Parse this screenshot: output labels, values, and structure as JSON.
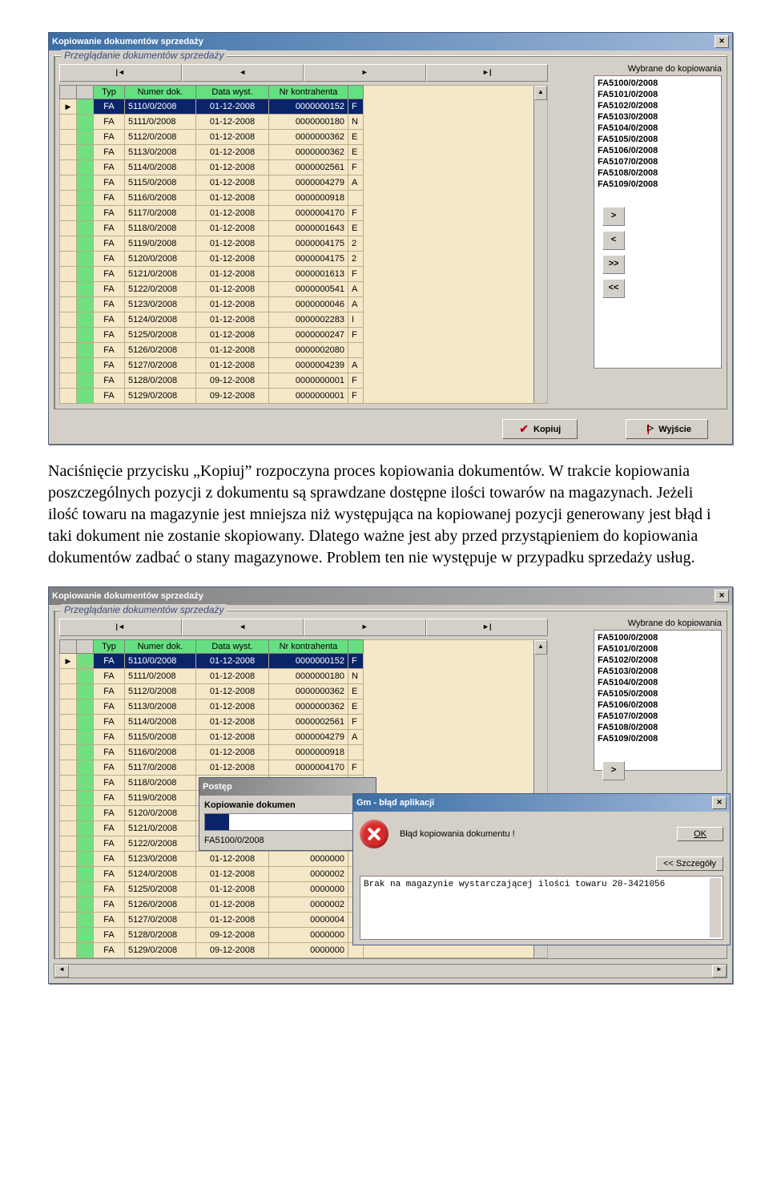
{
  "window_title": "Kopiowanie dokumentów sprzedaży",
  "group_legend": "Przeglądanie dokumentów sprzedaży",
  "columns": {
    "typ": "Typ",
    "num": "Numer dok.",
    "date": "Data wyst.",
    "kontr": "Nr kontrahenta"
  },
  "rows": [
    {
      "typ": "FA",
      "num": "5110/0/2008",
      "date": "01-12-2008",
      "kontr": "0000000152",
      "x": "F",
      "sel": true
    },
    {
      "typ": "FA",
      "num": "5111/0/2008",
      "date": "01-12-2008",
      "kontr": "0000000180",
      "x": "N"
    },
    {
      "typ": "FA",
      "num": "5112/0/2008",
      "date": "01-12-2008",
      "kontr": "0000000362",
      "x": "E"
    },
    {
      "typ": "FA",
      "num": "5113/0/2008",
      "date": "01-12-2008",
      "kontr": "0000000362",
      "x": "E"
    },
    {
      "typ": "FA",
      "num": "5114/0/2008",
      "date": "01-12-2008",
      "kontr": "0000002561",
      "x": "F"
    },
    {
      "typ": "FA",
      "num": "5115/0/2008",
      "date": "01-12-2008",
      "kontr": "0000004279",
      "x": "A"
    },
    {
      "typ": "FA",
      "num": "5116/0/2008",
      "date": "01-12-2008",
      "kontr": "0000000918",
      "x": ""
    },
    {
      "typ": "FA",
      "num": "5117/0/2008",
      "date": "01-12-2008",
      "kontr": "0000004170",
      "x": "F"
    },
    {
      "typ": "FA",
      "num": "5118/0/2008",
      "date": "01-12-2008",
      "kontr": "0000001643",
      "x": "E"
    },
    {
      "typ": "FA",
      "num": "5119/0/2008",
      "date": "01-12-2008",
      "kontr": "0000004175",
      "x": "2"
    },
    {
      "typ": "FA",
      "num": "5120/0/2008",
      "date": "01-12-2008",
      "kontr": "0000004175",
      "x": "2"
    },
    {
      "typ": "FA",
      "num": "5121/0/2008",
      "date": "01-12-2008",
      "kontr": "0000001613",
      "x": "F"
    },
    {
      "typ": "FA",
      "num": "5122/0/2008",
      "date": "01-12-2008",
      "kontr": "0000000541",
      "x": "A"
    },
    {
      "typ": "FA",
      "num": "5123/0/2008",
      "date": "01-12-2008",
      "kontr": "0000000046",
      "x": "A"
    },
    {
      "typ": "FA",
      "num": "5124/0/2008",
      "date": "01-12-2008",
      "kontr": "0000002283",
      "x": "I"
    },
    {
      "typ": "FA",
      "num": "5125/0/2008",
      "date": "01-12-2008",
      "kontr": "0000000247",
      "x": "F"
    },
    {
      "typ": "FA",
      "num": "5126/0/2008",
      "date": "01-12-2008",
      "kontr": "0000002080",
      "x": ""
    },
    {
      "typ": "FA",
      "num": "5127/0/2008",
      "date": "01-12-2008",
      "kontr": "0000004239",
      "x": "A"
    },
    {
      "typ": "FA",
      "num": "5128/0/2008",
      "date": "09-12-2008",
      "kontr": "0000000001",
      "x": "F"
    },
    {
      "typ": "FA",
      "num": "5129/0/2008",
      "date": "09-12-2008",
      "kontr": "0000000001",
      "x": "F"
    }
  ],
  "rows2": [
    {
      "typ": "FA",
      "num": "5110/0/2008",
      "date": "01-12-2008",
      "kontr": "0000000152",
      "x": "F",
      "sel": true
    },
    {
      "typ": "FA",
      "num": "5111/0/2008",
      "date": "01-12-2008",
      "kontr": "0000000180",
      "x": "N"
    },
    {
      "typ": "FA",
      "num": "5112/0/2008",
      "date": "01-12-2008",
      "kontr": "0000000362",
      "x": "E"
    },
    {
      "typ": "FA",
      "num": "5113/0/2008",
      "date": "01-12-2008",
      "kontr": "0000000362",
      "x": "E"
    },
    {
      "typ": "FA",
      "num": "5114/0/2008",
      "date": "01-12-2008",
      "kontr": "0000002561",
      "x": "F"
    },
    {
      "typ": "FA",
      "num": "5115/0/2008",
      "date": "01-12-2008",
      "kontr": "0000004279",
      "x": "A"
    },
    {
      "typ": "FA",
      "num": "5116/0/2008",
      "date": "01-12-2008",
      "kontr": "0000000918",
      "x": ""
    },
    {
      "typ": "FA",
      "num": "5117/0/2008",
      "date": "01-12-2008",
      "kontr": "0000004170",
      "x": "F"
    },
    {
      "typ": "FA",
      "num": "5118/0/2008",
      "date": "",
      "kontr": "",
      "x": ""
    },
    {
      "typ": "FA",
      "num": "5119/0/2008",
      "date": "",
      "kontr": "",
      "x": ""
    },
    {
      "typ": "FA",
      "num": "5120/0/2008",
      "date": "",
      "kontr": "",
      "x": ""
    },
    {
      "typ": "FA",
      "num": "5121/0/2008",
      "date": "",
      "kontr": "",
      "x": ""
    },
    {
      "typ": "FA",
      "num": "5122/0/2008",
      "date": "",
      "kontr": "",
      "x": ""
    },
    {
      "typ": "FA",
      "num": "5123/0/2008",
      "date": "01-12-2008",
      "kontr": "0000000",
      "x": ""
    },
    {
      "typ": "FA",
      "num": "5124/0/2008",
      "date": "01-12-2008",
      "kontr": "0000002",
      "x": ""
    },
    {
      "typ": "FA",
      "num": "5125/0/2008",
      "date": "01-12-2008",
      "kontr": "0000000",
      "x": ""
    },
    {
      "typ": "FA",
      "num": "5126/0/2008",
      "date": "01-12-2008",
      "kontr": "0000002",
      "x": ""
    },
    {
      "typ": "FA",
      "num": "5127/0/2008",
      "date": "01-12-2008",
      "kontr": "0000004",
      "x": ""
    },
    {
      "typ": "FA",
      "num": "5128/0/2008",
      "date": "09-12-2008",
      "kontr": "0000000",
      "x": ""
    },
    {
      "typ": "FA",
      "num": "5129/0/2008",
      "date": "09-12-2008",
      "kontr": "0000000",
      "x": ""
    }
  ],
  "selected_label": "Wybrane do kopiowania",
  "selected": [
    "FA5100/0/2008",
    "FA5101/0/2008",
    "FA5102/0/2008",
    "FA5103/0/2008",
    "FA5104/0/2008",
    "FA5105/0/2008",
    "FA5106/0/2008",
    "FA5107/0/2008",
    "FA5108/0/2008",
    "FA5109/0/2008"
  ],
  "move": {
    "add": ">",
    "remove": "<",
    "addall": ">>",
    "removeall": "<<"
  },
  "kopiuj": "Kopiuj",
  "wyjscie": "Wyjście",
  "paragraph": "Naciśnięcie przycisku „Kopiuj” rozpoczyna proces kopiowania dokumentów. W trakcie kopiowania poszczególnych pozycji z dokumentu są sprawdzane dostępne ilości towarów na magazynach. Jeżeli ilość towaru na magazynie jest mniejsza niż występująca na kopiowanej pozycji generowany jest błąd i taki dokument nie zostanie skopiowany. Dlatego ważne jest aby przed przystąpieniem do kopiowania dokumentów zadbać o stany magazynowe. Problem ten nie występuje w przypadku sprzedaży usług.",
  "progress": {
    "title": "Postęp",
    "label": "Kopiowanie dokumen",
    "doc": "FA5100/0/2008"
  },
  "error": {
    "title": "Gm - błąd aplikacji",
    "msg": "Błąd kopiowania dokumentu !",
    "ok": "OK",
    "details": "<< Szczegóły",
    "memo": "Brak na magazynie wystarczającej ilości towaru 20-3421056"
  }
}
